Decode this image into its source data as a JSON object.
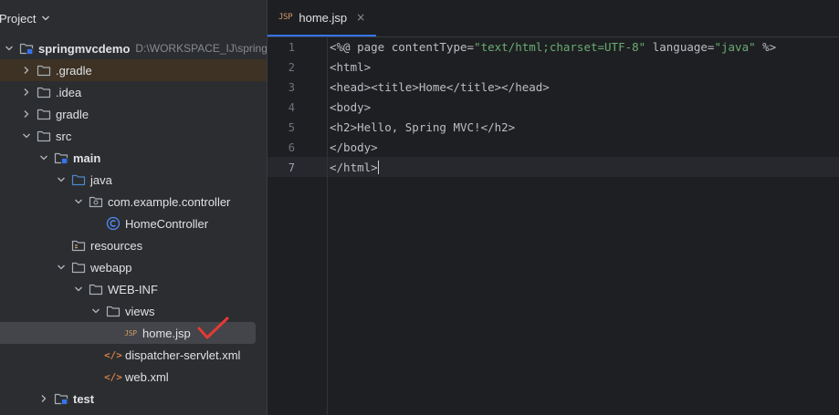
{
  "project_panel": {
    "title": "Project",
    "tree": [
      {
        "label": "springmvcdemo",
        "hint": "D:\\WORKSPACE_IJ\\springm",
        "icon": "module-folder-icon",
        "bold": true
      },
      {
        "label": ".gradle",
        "icon": "folder-icon"
      },
      {
        "label": ".idea",
        "icon": "folder-icon"
      },
      {
        "label": "gradle",
        "icon": "folder-icon"
      },
      {
        "label": "src",
        "icon": "folder-icon"
      },
      {
        "label": "main",
        "icon": "source-root-folder-icon",
        "bold": true
      },
      {
        "label": "java",
        "icon": "source-folder-icon"
      },
      {
        "label": "com.example.controller",
        "icon": "package-icon"
      },
      {
        "label": "HomeController",
        "icon": "class-icon"
      },
      {
        "label": "resources",
        "icon": "resources-folder-icon"
      },
      {
        "label": "webapp",
        "icon": "web-folder-icon"
      },
      {
        "label": "WEB-INF",
        "icon": "folder-icon"
      },
      {
        "label": "views",
        "icon": "folder-icon"
      },
      {
        "label": "home.jsp",
        "icon": "jsp-file-icon"
      },
      {
        "label": "dispatcher-servlet.xml",
        "icon": "xml-file-icon"
      },
      {
        "label": "web.xml",
        "icon": "xml-file-icon"
      },
      {
        "label": "test",
        "icon": "test-folder-icon",
        "bold": true
      }
    ]
  },
  "editor": {
    "tab": {
      "label": "home.jsp",
      "badge": "JSP",
      "close": "×"
    },
    "current_line": 7,
    "lines": [
      {
        "n": "1",
        "parts": [
          {
            "t": "<%@ page contentType="
          },
          {
            "t": "\"text/html;charset=UTF-8\"",
            "s": true
          },
          {
            "t": " language="
          },
          {
            "t": "\"java\"",
            "s": true
          },
          {
            "t": " %>"
          }
        ]
      },
      {
        "n": "2",
        "parts": [
          {
            "t": "<html>"
          }
        ]
      },
      {
        "n": "3",
        "parts": [
          {
            "t": "<head><title>Home</title></head>"
          }
        ]
      },
      {
        "n": "4",
        "parts": [
          {
            "t": "<body>"
          }
        ]
      },
      {
        "n": "5",
        "parts": [
          {
            "t": "<h2>Hello, Spring MVC!</h2>"
          }
        ]
      },
      {
        "n": "6",
        "parts": [
          {
            "t": "</body>"
          }
        ]
      },
      {
        "n": "7",
        "parts": [
          {
            "t": "</html>"
          }
        ]
      }
    ]
  },
  "colors": {
    "accent": "#3574f0",
    "folder": "#a9aeb6",
    "source_folder": "#4a88c7",
    "class": "#548af7",
    "string": "#6aab73",
    "checkmark": "#e53935"
  }
}
